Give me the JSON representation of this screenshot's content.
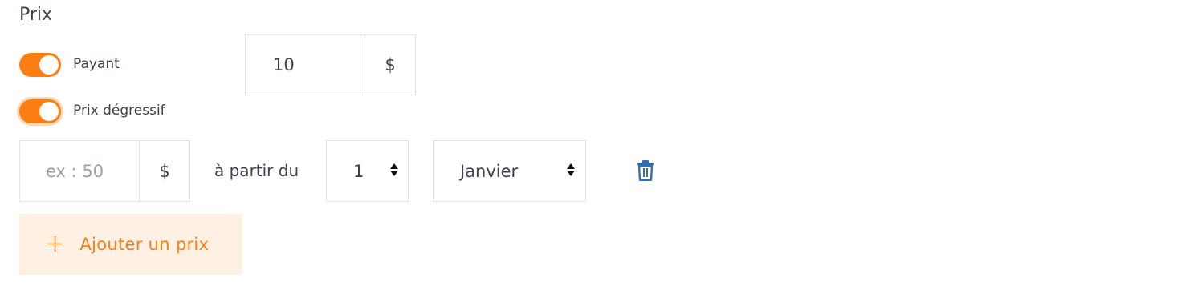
{
  "section": {
    "title": "Prix"
  },
  "toggles": [
    {
      "label": "Payant",
      "on": true
    },
    {
      "label": "Prix dégressif",
      "on": true
    }
  ],
  "price": {
    "value": "10",
    "currency": "$"
  },
  "tier": {
    "price_placeholder": "ex : 50",
    "currency": "$",
    "from_label": "à partir du",
    "day_value": "1",
    "month_value": "Janvier"
  },
  "icons": {
    "delete": "trash-icon",
    "add": "plus-icon",
    "spinner": "updown-arrows-icon"
  },
  "add_button": {
    "plus": "+",
    "label": "Ajouter un prix"
  },
  "colors": {
    "accent": "#fb7e14",
    "accent_light": "#fff0e4",
    "danger_icon": "#2f6fb0"
  }
}
